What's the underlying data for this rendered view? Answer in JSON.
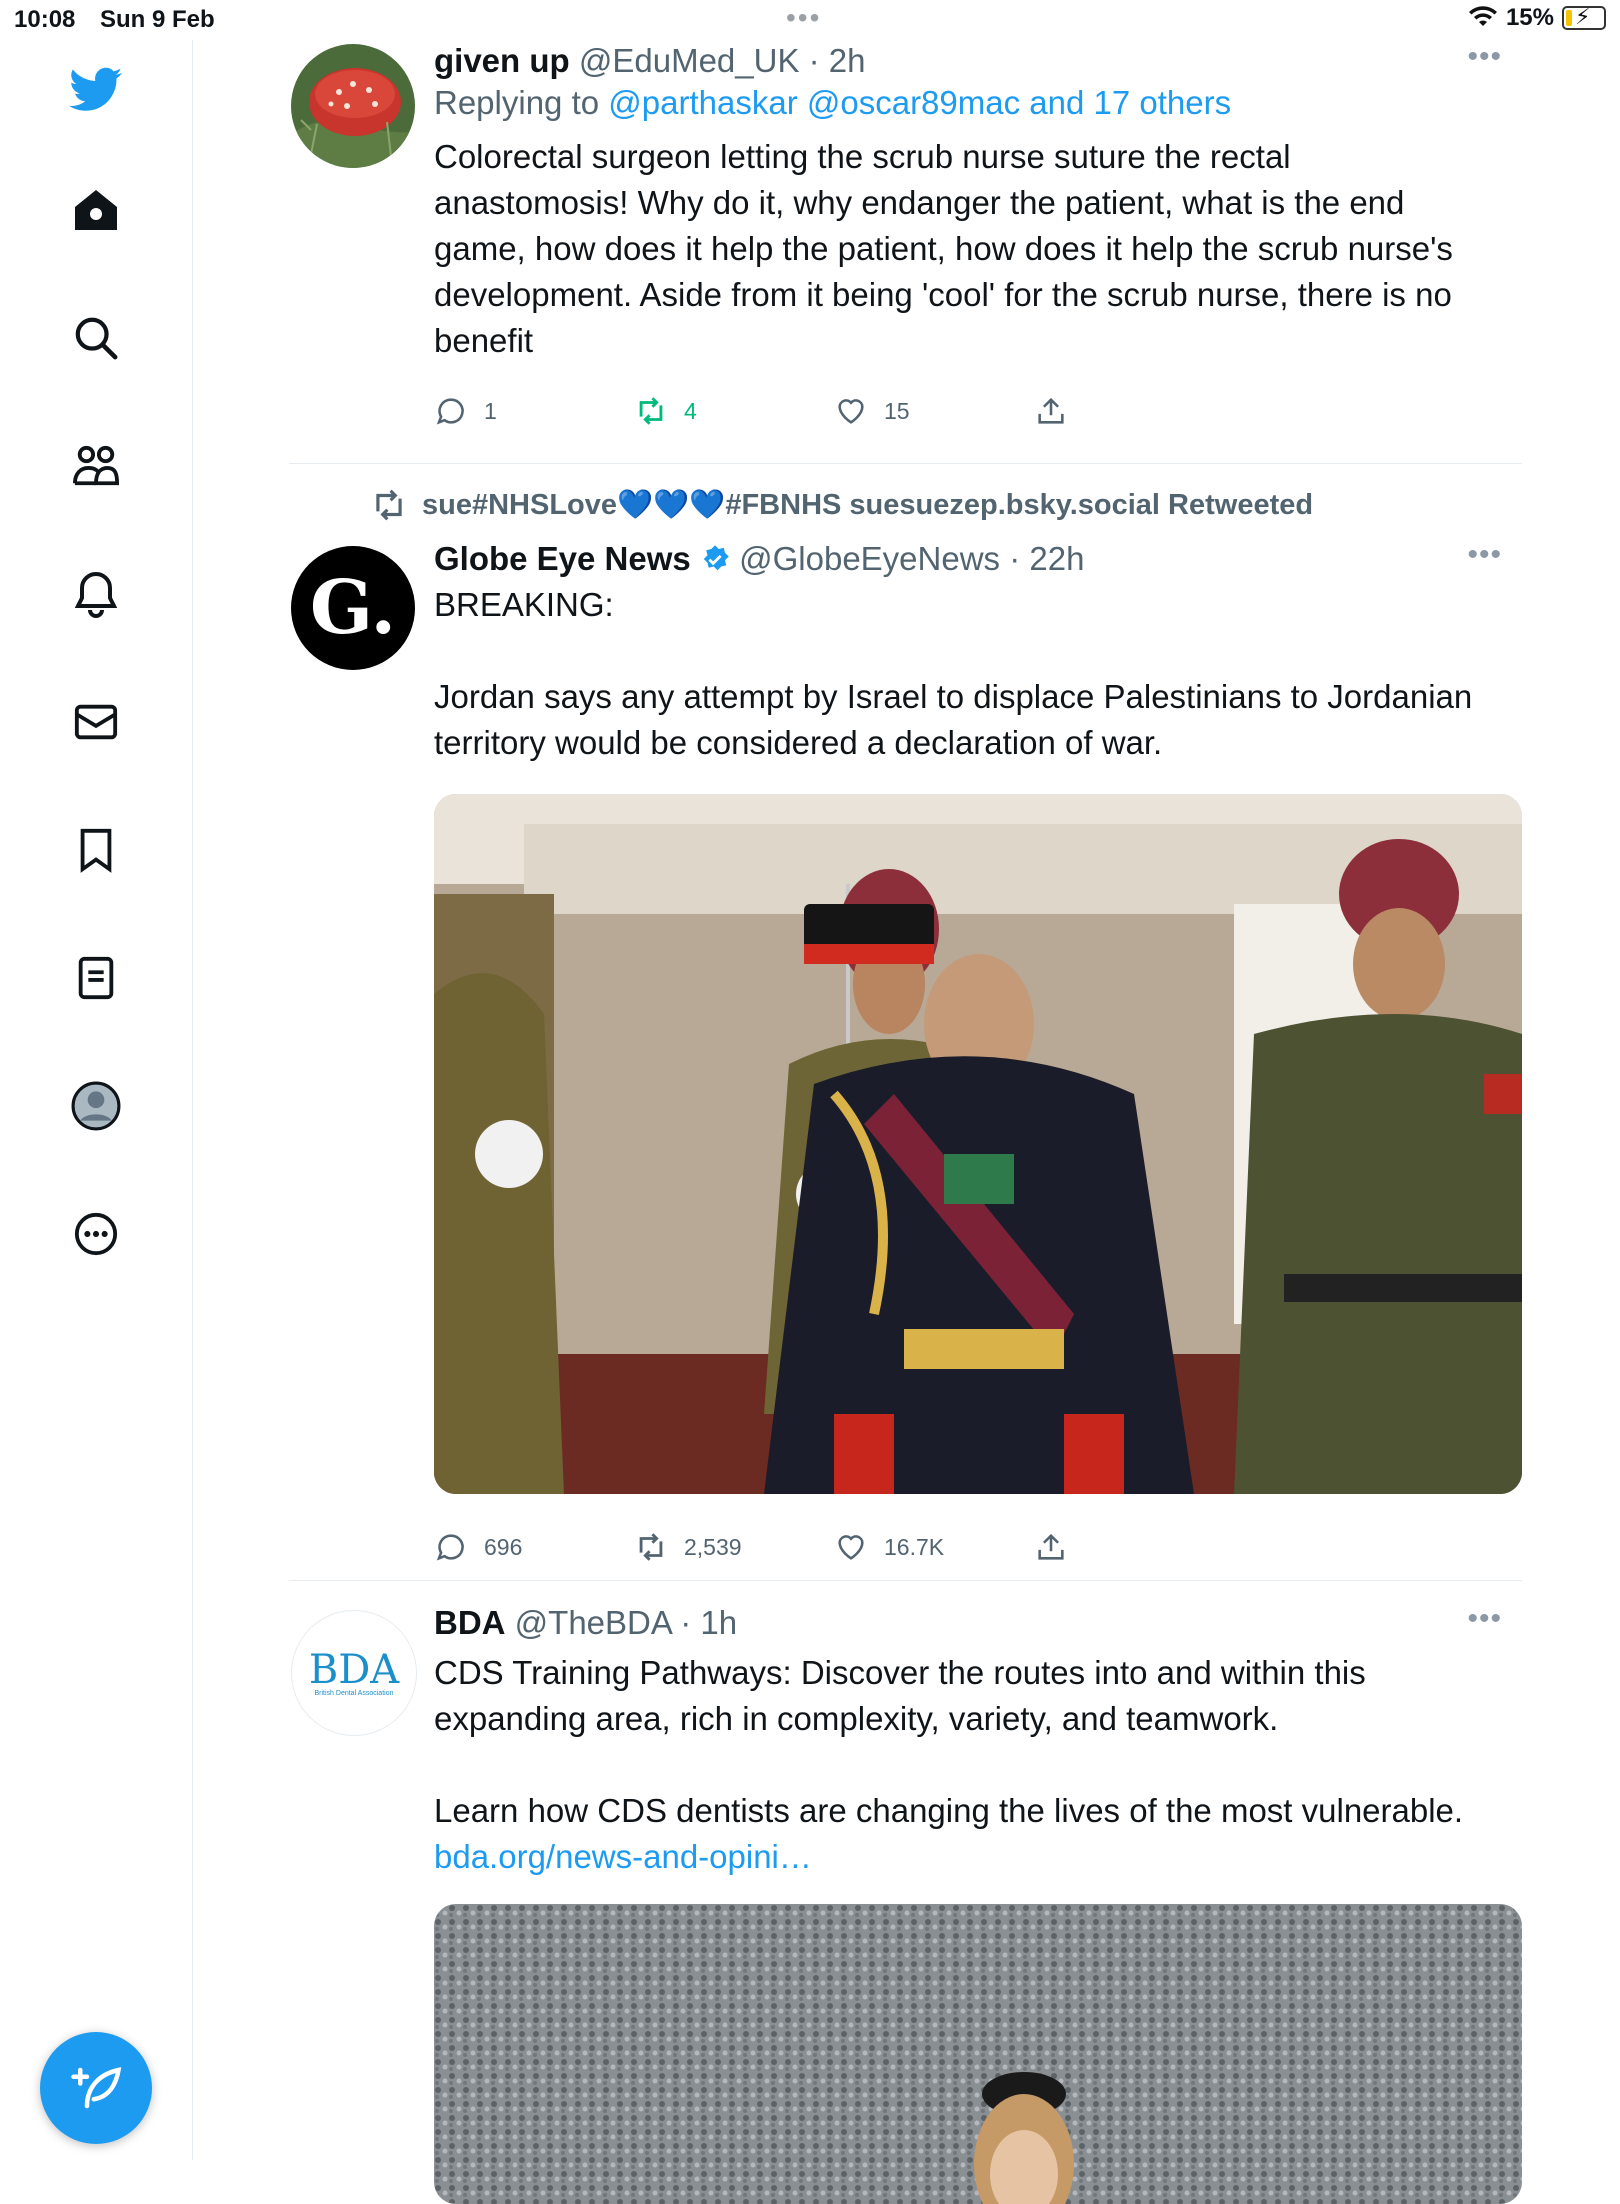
{
  "status_bar": {
    "time": "10:08",
    "date": "Sun 9 Feb",
    "battery": "15%"
  },
  "nav": {
    "icons": [
      "twitter-bird-icon",
      "home-icon",
      "search-icon",
      "communities-icon",
      "notifications-icon",
      "messages-icon",
      "bookmarks-icon",
      "lists-icon",
      "profile-icon",
      "more-icon",
      "compose-icon"
    ]
  },
  "tweets": [
    {
      "name": "given up",
      "handle": "@EduMed_UK",
      "time": "· 2h",
      "reply_prefix": "Replying to",
      "reply_to": "@parthaskar @oscar89mac and 17 others",
      "text": "Colorectal surgeon letting the scrub nurse suture the rectal anastomosis! Why do it, why endanger the patient, what is the end game, how does it help the patient, how does it help the scrub nurse's development. Aside from it being 'cool' for the scrub nurse, there is no benefit",
      "replies": "1",
      "retweets": "4",
      "likes": "15",
      "retweeted_by_me": true
    },
    {
      "retweet_label": "sue#NHSLove💙💙💙#FBNHS suesuezep.bsky.social Retweeted",
      "name": "Globe Eye News",
      "verified": true,
      "handle": "@GlobeEyeNews",
      "time": "· 22h",
      "avatar_letter": "G.",
      "text_line1": "BREAKING:",
      "text_line2": "Jordan says any attempt by Israel to displace Palestinians to Jordanian territory would be considered a declaration of war.",
      "replies": "696",
      "retweets": "2,539",
      "likes": "16.7K"
    },
    {
      "name": "BDA",
      "handle": "@TheBDA",
      "time": "· 1h",
      "avatar_text": "BDA",
      "avatar_sub": "British Dental Association",
      "text_line1": "CDS Training Pathways: Discover the routes into and within this expanding area, rich in complexity, variety, and teamwork.",
      "text_line2": "Learn how CDS dentists are changing the lives of the most vulnerable.",
      "link": "bda.org/news-and-opini…"
    }
  ],
  "colors": {
    "accent": "#1d9bf0",
    "retweet_green": "#00ba7c",
    "secondary_text": "#536471"
  }
}
